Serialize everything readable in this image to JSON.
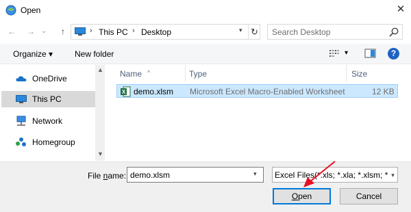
{
  "window": {
    "title": "Open",
    "close_glyph": "✕"
  },
  "nav": {
    "back_glyph": "←",
    "forward_glyph": "→",
    "recent_glyph": "⌄",
    "up_glyph": "↑",
    "breadcrumbs": [
      "This PC",
      "Desktop"
    ],
    "crumb_sep": "›",
    "dropdown_glyph": "▾",
    "refresh_glyph": "↻",
    "search_placeholder": "Search Desktop"
  },
  "toolbar": {
    "organize_label": "Organize ▾",
    "new_folder_label": "New folder",
    "view_dropdown_glyph": "▾",
    "help_glyph": "?"
  },
  "sidebar": {
    "items": [
      {
        "label": "OneDrive",
        "icon": "onedrive-cloud-icon",
        "selected": false
      },
      {
        "label": "This PC",
        "icon": "this-pc-icon",
        "selected": true
      },
      {
        "label": "Network",
        "icon": "network-icon",
        "selected": false
      },
      {
        "label": "Homegroup",
        "icon": "homegroup-icon",
        "selected": false
      }
    ],
    "scroll_up_glyph": "▲",
    "scroll_down_glyph": "▼"
  },
  "files": {
    "columns": {
      "name": "Name",
      "type": "Type",
      "size": "Size",
      "sort_glyph": "^"
    },
    "rows": [
      {
        "name": "demo.xlsm",
        "type": "Microsoft Excel Macro-Enabled Worksheet",
        "size": "12 KB",
        "icon": "excel-file-icon",
        "selected": true
      }
    ]
  },
  "footer": {
    "file_name_label_pre": "File ",
    "file_name_label_ul": "n",
    "file_name_label_post": "ame:",
    "file_name_value": "demo.xlsm",
    "dropdown_glyph": "▾",
    "filter_value": "Excel Files(*.xls; *.xla; *.xlsm; *.d",
    "open_ul": "O",
    "open_rest": "pen",
    "cancel_label": "Cancel"
  },
  "colors": {
    "accent": "#0078d7",
    "selection_bg": "#cce8ff",
    "excel_green": "#1e7145",
    "annotation_red": "#e81123"
  }
}
